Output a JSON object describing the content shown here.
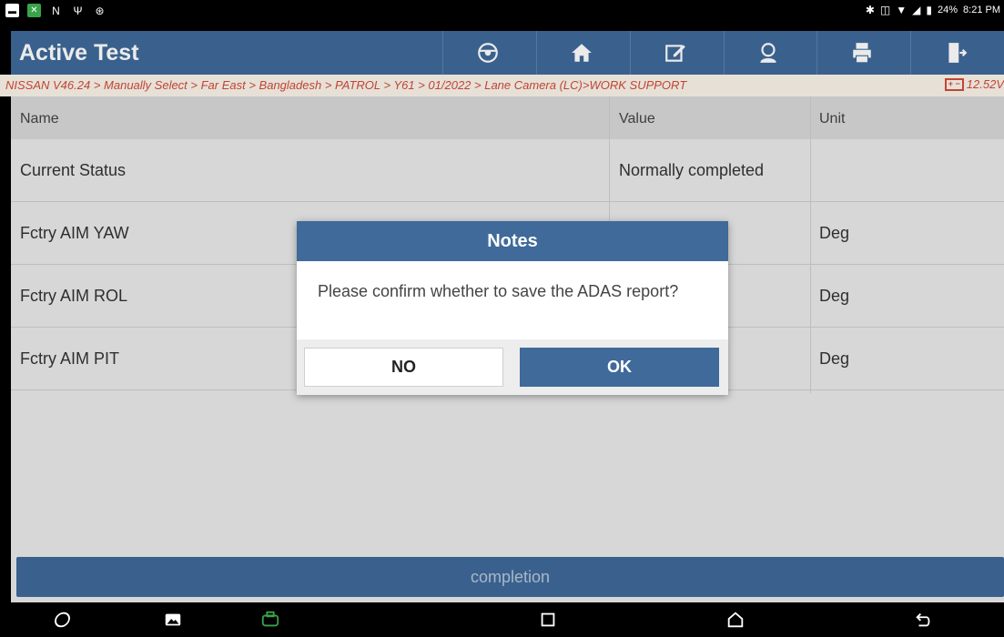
{
  "status_bar": {
    "left_icons": [
      "image-icon",
      "app-x-icon",
      "n-icon",
      "usb-icon",
      "radiation-icon"
    ],
    "battery_percent": "24%",
    "time": "8:21 PM"
  },
  "header": {
    "title": "Active Test",
    "tools": [
      "steering-icon",
      "home-icon",
      "edit-icon",
      "support-icon",
      "print-icon",
      "exit-icon"
    ]
  },
  "breadcrumb": {
    "path": "NISSAN V46.24 > Manually Select > Far East > Bangladesh > PATROL > Y61 > 01/2022 > Lane Camera (LC)>WORK SUPPORT",
    "voltage": "12.52V"
  },
  "table": {
    "headers": {
      "name": "Name",
      "value": "Value",
      "unit": "Unit"
    },
    "rows": [
      {
        "name": "Current Status",
        "value": "Normally completed",
        "unit": ""
      },
      {
        "name": "Fctry AIM YAW",
        "value": "",
        "unit": "Deg"
      },
      {
        "name": "Fctry AIM ROL",
        "value": "",
        "unit": "Deg"
      },
      {
        "name": "Fctry AIM PIT",
        "value": "",
        "unit": "Deg"
      }
    ]
  },
  "completion_label": "completion",
  "dialog": {
    "title": "Notes",
    "message": "Please confirm whether to save the ADAS report?",
    "no_label": "NO",
    "ok_label": "OK"
  },
  "navbar": {
    "icons": [
      "browser-icon",
      "gallery-icon",
      "vci-icon",
      "recent-apps-icon",
      "home-nav-icon",
      "back-icon"
    ]
  },
  "colors": {
    "accent": "#3f6a9a",
    "breadcrumb_text": "#d24b38",
    "breadcrumb_bg": "#fbf3ea"
  }
}
